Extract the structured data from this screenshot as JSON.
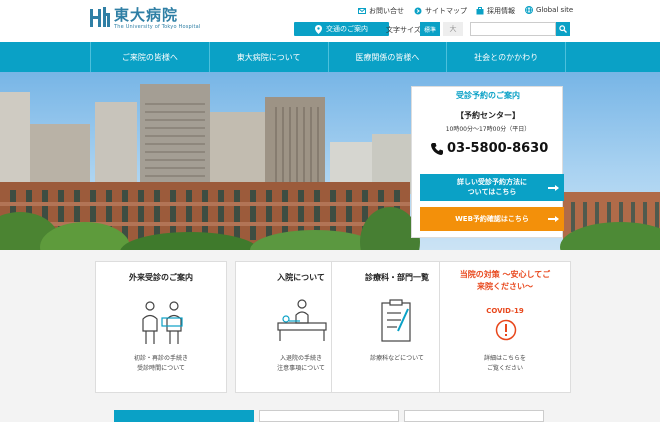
{
  "header": {
    "logo_ja": "東大病院",
    "logo_en": "The University of Tokyo Hospital",
    "util_links": [
      {
        "label": "お問い合せ",
        "icon": "mail-icon"
      },
      {
        "label": "サイトマップ",
        "icon": "sitemap-icon"
      },
      {
        "label": "採用情報",
        "icon": "recruit-icon"
      },
      {
        "label": "Global site",
        "icon": "globe-icon"
      }
    ],
    "access_label": "交通のご案内",
    "fontsize_label": "文字サイズ",
    "fontsize_std": "標準",
    "fontsize_large": "大"
  },
  "nav": {
    "items": [
      "ご来院の皆様へ",
      "東大病院について",
      "医療関係の皆様へ",
      "社会とのかかわり"
    ]
  },
  "reservation": {
    "title": "受診予約のご案内",
    "center": "【予約センター】",
    "hours": "10時00分～17時00分（平日）",
    "phone": "03-5800-8630",
    "button1_line1": "詳しい受診予約方法に",
    "button1_line2": "ついてはこちら",
    "button2": "WEB予約確認はこちら"
  },
  "cards": [
    {
      "title": "外来受診のご案内",
      "desc1": "初診・再診の手続き",
      "desc2": "受診時間について",
      "icon": "outpatient-icon"
    },
    {
      "title": "入院について",
      "desc1": "入退院の手続き",
      "desc2": "注意事項について",
      "icon": "inpatient-icon"
    },
    {
      "title": "診療科・部門一覧",
      "desc1": "診療科などについて",
      "desc2": "",
      "icon": "department-icon"
    },
    {
      "title_line1": "当院の対策 ～安心してご",
      "title_line2": "来院ください～",
      "covid": "COVID-19",
      "desc1": "詳細はこちらを",
      "desc2": "ご覧ください",
      "icon": "alert-icon"
    }
  ],
  "colors": {
    "accent": "#0aa1c6",
    "orange": "#f3900a",
    "alert": "#e8471c",
    "brand": "#2f7fa5"
  }
}
